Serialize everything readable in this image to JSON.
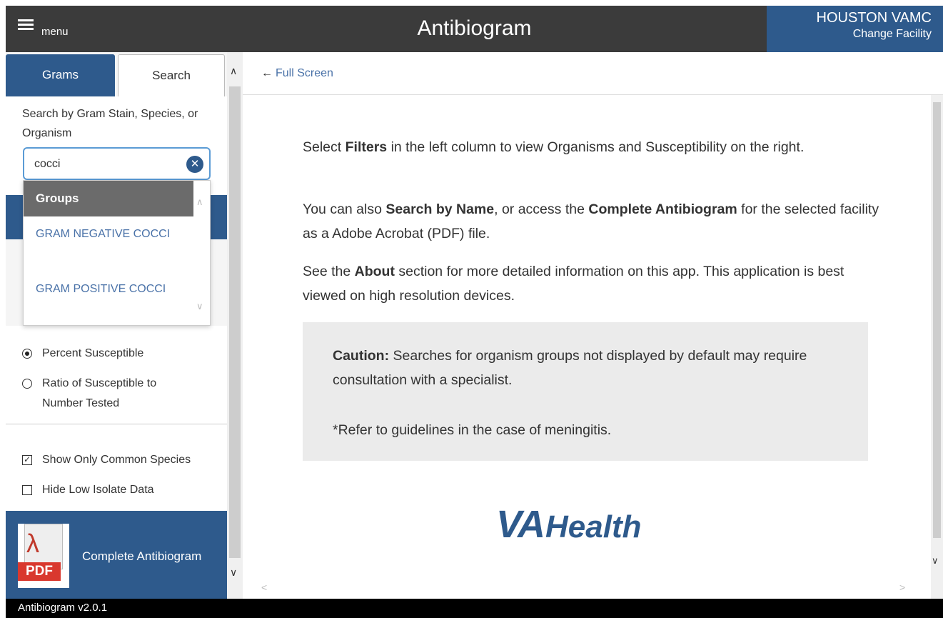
{
  "header": {
    "menu_label": "menu",
    "title": "Antibiogram",
    "facility_name": "HOUSTON VAMC",
    "facility_change": "Change Facility"
  },
  "sidebar": {
    "tabs": [
      {
        "label": "Grams",
        "active": false
      },
      {
        "label": "Search",
        "active": true
      }
    ],
    "search": {
      "hint": "Search by Gram Stain, Species, or Organism",
      "value": "cocci",
      "clear_icon": "close-circle-icon"
    },
    "dropdown": {
      "header": "Groups",
      "items": [
        "GRAM NEGATIVE COCCI",
        "GRAM POSITIVE COCCI"
      ]
    },
    "display_options": [
      {
        "label": "Percent Susceptible",
        "selected": true
      },
      {
        "label": "Ratio of Susceptible to Number Tested",
        "selected": false
      }
    ],
    "filters": [
      {
        "label": "Show Only Common Species",
        "checked": true
      },
      {
        "label": "Hide Low Isolate Data",
        "checked": false
      }
    ],
    "pdf": {
      "icon_tag": "PDF",
      "label": "Complete Antibiogram"
    }
  },
  "main": {
    "full_screen_label": "Full Screen",
    "paragraph1": {
      "a": "Select ",
      "b": "Filters",
      "c": " in the left column to view Organisms and Susceptibility on the right."
    },
    "paragraph2": {
      "a": "You can also ",
      "b": "Search by Name",
      "c": ", or access the ",
      "d": "Complete Antibiogram",
      "e": " for the selected facility as a Adobe Acrobat (PDF) file."
    },
    "paragraph3": {
      "a": "See the ",
      "b": "About",
      "c": " section for more detailed information on this app. This application is best viewed on high resolution devices."
    },
    "caution": {
      "label": "Caution:",
      "text": " Searches for organism groups not displayed by default may require consultation with a specialist.",
      "reference": "*Refer to guidelines in the case of meningitis."
    },
    "logo": {
      "va": "VA",
      "health": "Health"
    }
  },
  "footer": {
    "version": "Antibiogram v2.0.1"
  },
  "colors": {
    "header_bg": "#3b3b3b",
    "brand_blue": "#2e5a8c",
    "link_blue": "#4a72a8",
    "pdf_red": "#d9382e"
  }
}
